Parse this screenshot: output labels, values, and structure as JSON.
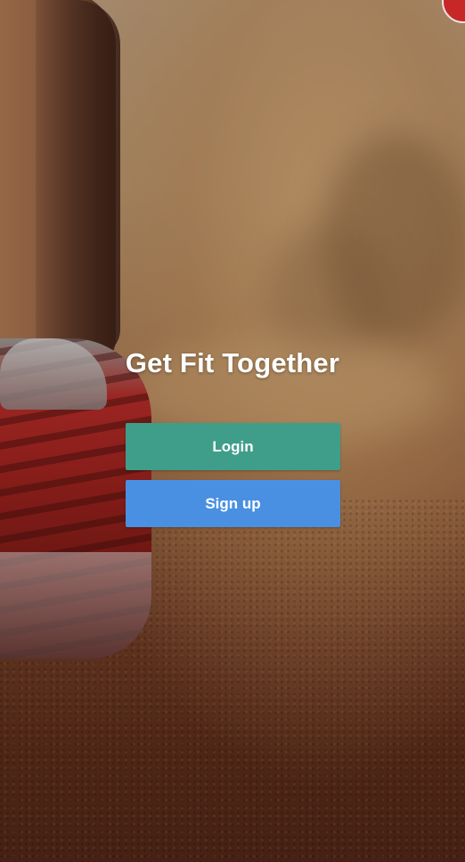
{
  "app": {
    "tagline": "Get Fit Together"
  },
  "actions": {
    "login_label": "Login",
    "signup_label": "Sign up"
  },
  "theme": {
    "login_color": "#3f9e8a",
    "signup_color": "#4a90e2",
    "text_color": "#ffffff"
  },
  "background": {
    "image": "runner-shoe-on-road-photo"
  }
}
